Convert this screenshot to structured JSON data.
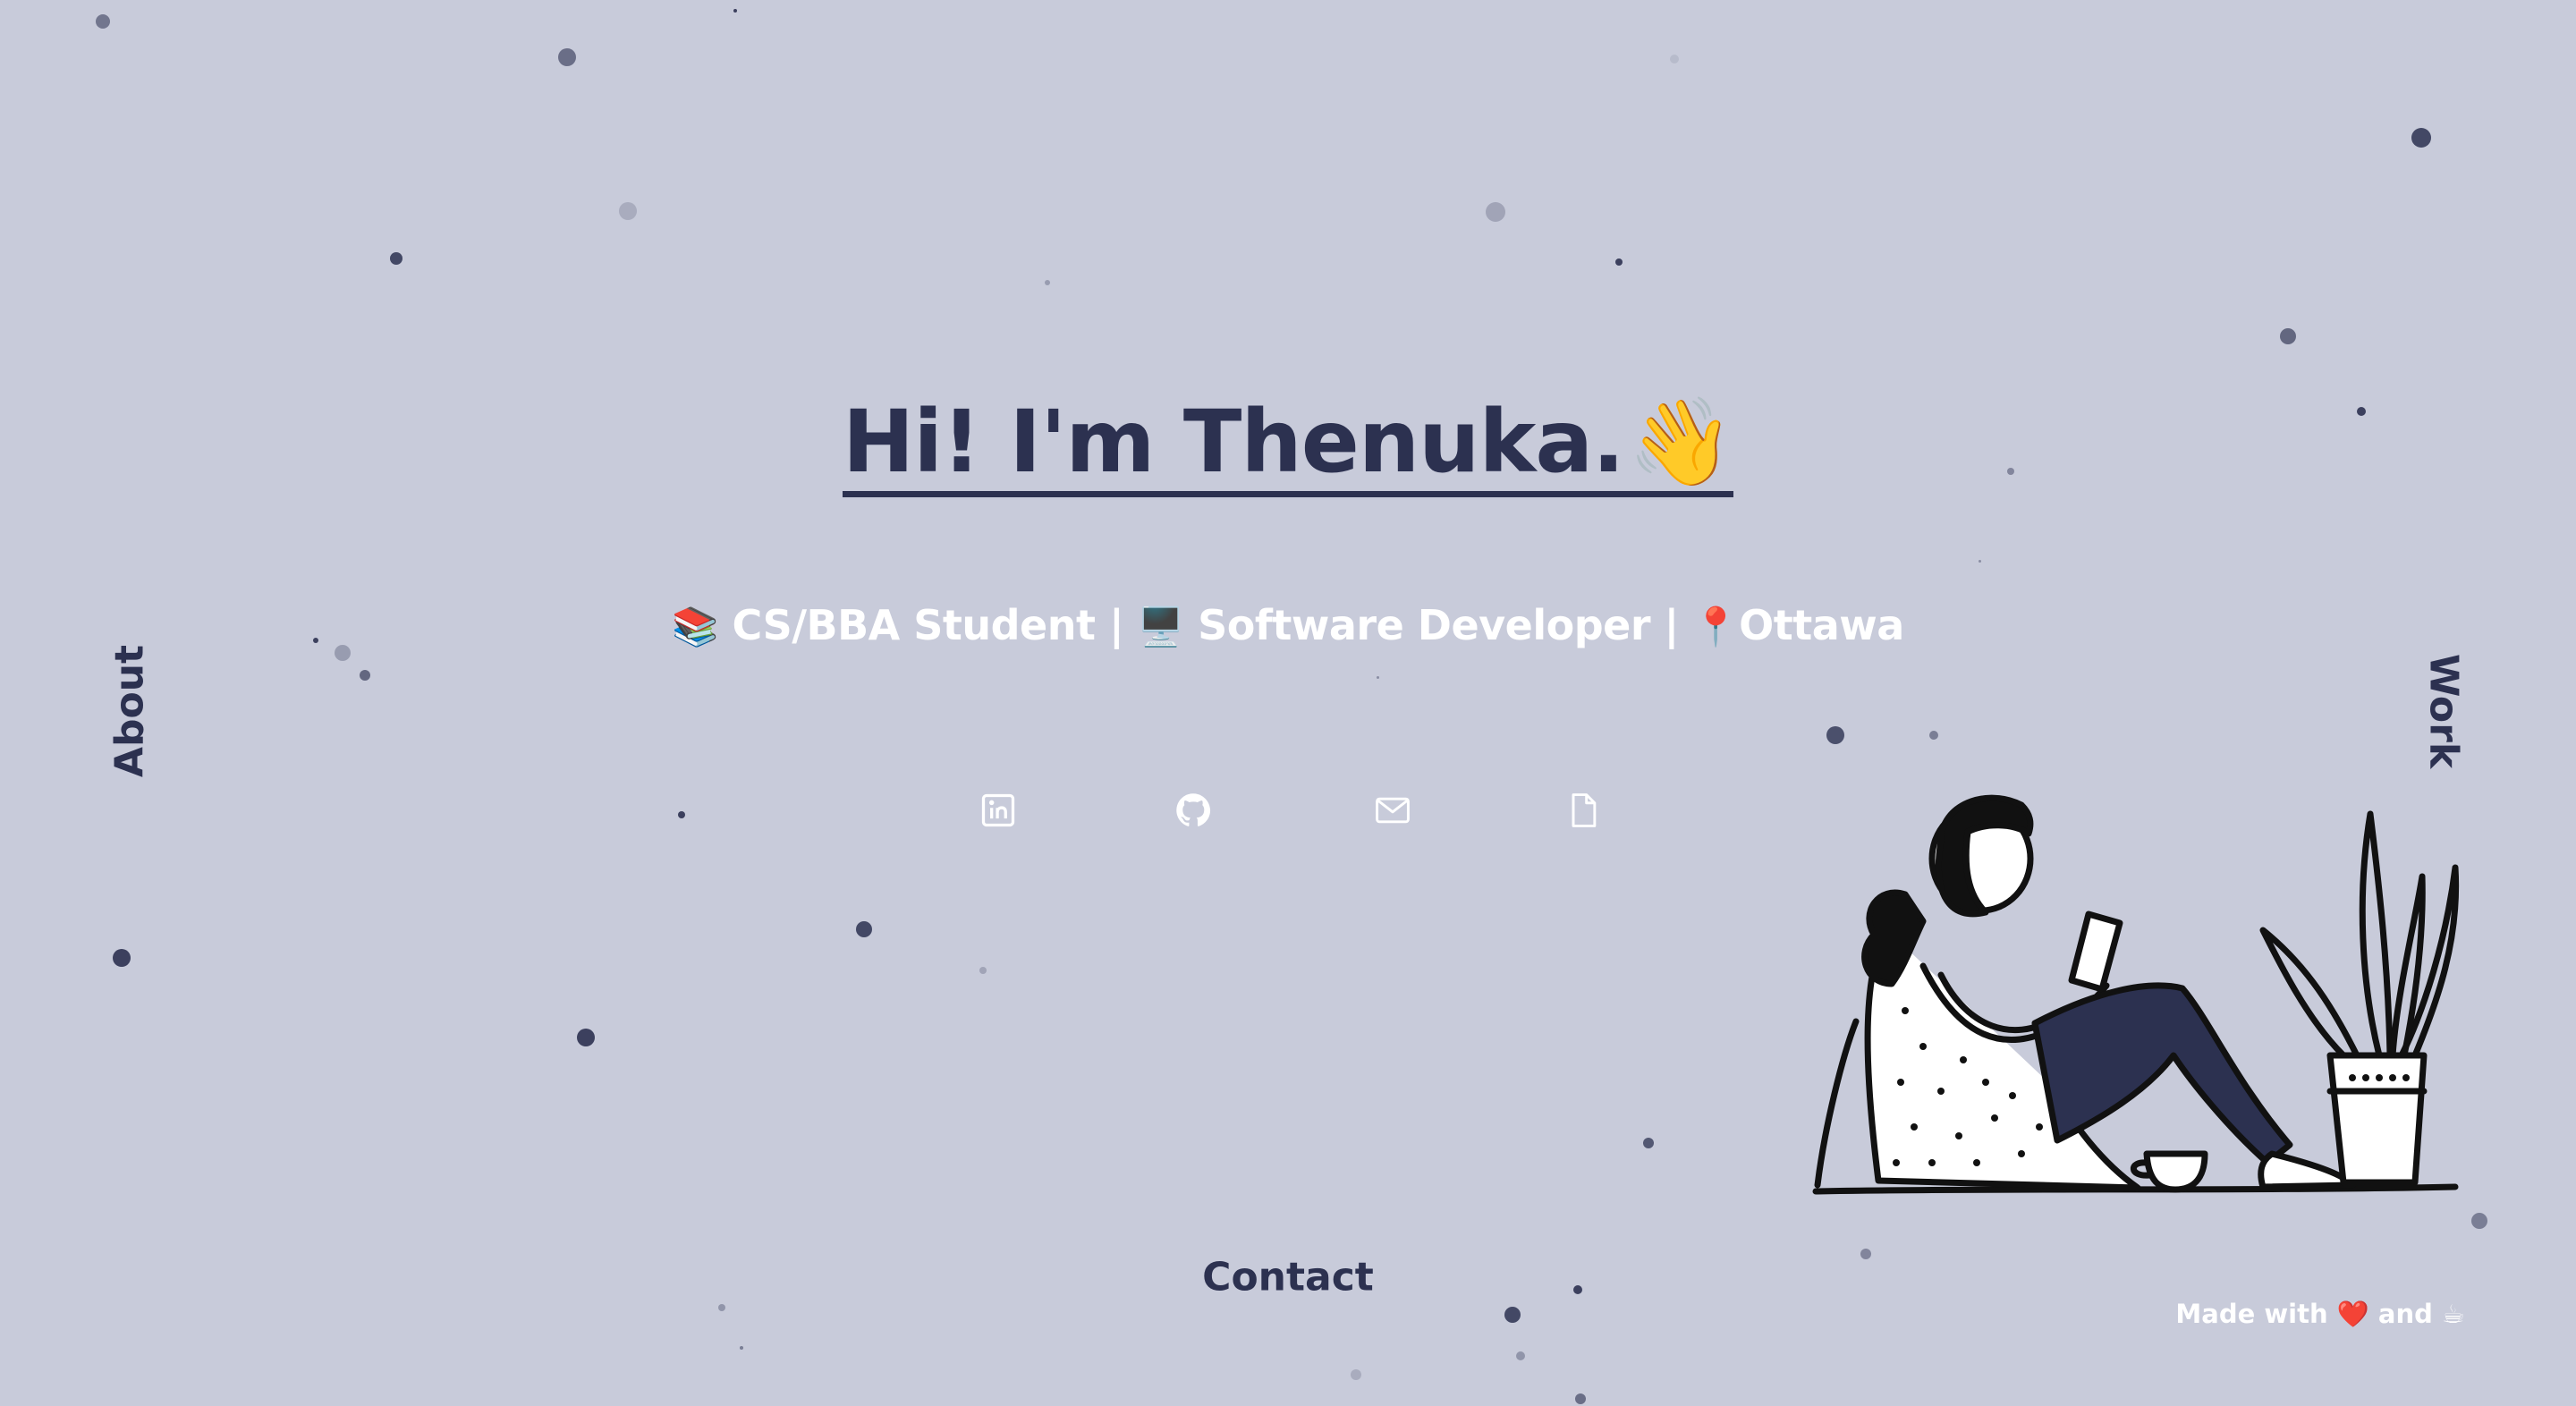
{
  "hero": {
    "title": "Hi! I'm Thenuka.",
    "title_emoji": "👋"
  },
  "subtitle": {
    "part1_emoji": "📚",
    "part1": " CS/BBA Student | ",
    "part2_emoji": "🖥️",
    "part2": " Software Developer | ",
    "part3_emoji": "📍",
    "part3": "Ottawa"
  },
  "socials": [
    {
      "icon": "linkedin-icon"
    },
    {
      "icon": "github-icon"
    },
    {
      "icon": "mail-icon"
    },
    {
      "icon": "document-icon"
    }
  ],
  "nav": {
    "about": "About",
    "work": "Work",
    "contact": "Contact"
  },
  "footer": {
    "made_with": "Made with ",
    "heart": "❤️",
    "and": " and ",
    "coffee": "☕"
  },
  "colors": {
    "background": "#c8cbda",
    "primary": "#2c3150",
    "text_light": "#ffffff"
  }
}
